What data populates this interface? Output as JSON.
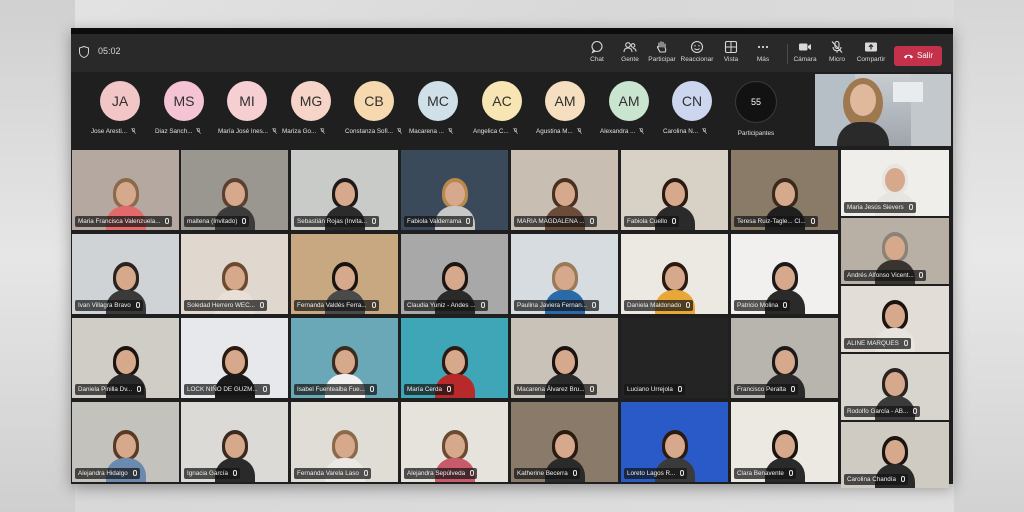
{
  "topbar": {
    "timer": "05:02",
    "tools": [
      {
        "label": "Chat",
        "icon": "chat-icon"
      },
      {
        "label": "Gente",
        "icon": "people-icon"
      },
      {
        "label": "Participar",
        "icon": "raise-hand-icon"
      },
      {
        "label": "Reaccionar",
        "icon": "reaction-icon"
      },
      {
        "label": "Vista",
        "icon": "view-icon"
      },
      {
        "label": "Más",
        "icon": "more-icon"
      },
      {
        "label": "Cámara",
        "icon": "camera-icon"
      },
      {
        "label": "Micro",
        "icon": "mic-off-icon"
      },
      {
        "label": "Compartir",
        "icon": "share-icon"
      }
    ],
    "leave_label": "Salir"
  },
  "roster": [
    {
      "initials": "JA",
      "name": "Jose Aresti...",
      "color": "#f2c5c7"
    },
    {
      "initials": "MS",
      "name": "Diaz Sanch...",
      "color": "#f4c4d4"
    },
    {
      "initials": "MI",
      "name": "María José Ines...",
      "color": "#f6cfd3"
    },
    {
      "initials": "MG",
      "name": "Mariza Go...",
      "color": "#f7d4c8"
    },
    {
      "initials": "CB",
      "name": "Constanza Sofi...",
      "color": "#f7d9b0"
    },
    {
      "initials": "MC",
      "name": "Macarena ...",
      "color": "#cfe0e8"
    },
    {
      "initials": "AC",
      "name": "Angelica C...",
      "color": "#f7e6b3"
    },
    {
      "initials": "AM",
      "name": "Agustina M...",
      "color": "#f5dfc0"
    },
    {
      "initials": "AM",
      "name": "Alexandra ...",
      "color": "#c9e4cf"
    },
    {
      "initials": "CN",
      "name": "Carolina N...",
      "color": "#cdd6ef"
    }
  ],
  "participants": {
    "count": "55",
    "label": "Participantes"
  },
  "tiles": [
    {
      "name": "Maria Francisca Valenzuela...",
      "wall": "#b5a8a0",
      "hair": "#8a6a4a",
      "shirt": "#e26a6a"
    },
    {
      "name": "maitena (Invitado)",
      "wall": "#9a9690",
      "hair": "#5a4030",
      "shirt": "#3b3b3b"
    },
    {
      "name": "Sebastián Rojas (Invita...",
      "wall": "#c9cbc8",
      "hair": "#1e1a18",
      "shirt": "#2b2b2b"
    },
    {
      "name": "Fabiola Valderrama",
      "wall": "#3a4a5a",
      "hair": "#b8894a",
      "shirt": "#c8c8c8"
    },
    {
      "name": "MARIA MAGDALENA ...",
      "wall": "#c8bfb2",
      "hair": "#4a3020",
      "shirt": "#6b4c3b"
    },
    {
      "name": "Fabiola Cuello",
      "wall": "#d8d2c6",
      "hair": "#2a1a12",
      "shirt": "#2a2a2a"
    },
    {
      "name": "Teresa Ruiz-Tagle... Cl...",
      "wall": "#8a7a68",
      "hair": "#3a2a1c",
      "shirt": "#1f1f1f"
    },
    {
      "name": "Maria Jesús Sievers",
      "wall": "#f0eeea",
      "hair": "#e8e4e0",
      "shirt": "#e8e4e0"
    },
    {
      "name": "Ivan Villagra Bravo",
      "wall": "#cfd3d6",
      "hair": "#2a2420",
      "shirt": "#3a3a3a"
    },
    {
      "name": "Soledad Herrero WEC...",
      "wall": "#e0d8ce",
      "hair": "#6a4a30",
      "shirt": "#e8e0d6"
    },
    {
      "name": "Fernanda Valdés Ferra...",
      "wall": "#c8a880",
      "hair": "#1a1410",
      "shirt": "#4a4a4a"
    },
    {
      "name": "Claudia Yuniz - Andes ...",
      "wall": "#a8a8a8",
      "hair": "#1c1612",
      "shirt": "#2a2a2a"
    },
    {
      "name": "Paulina Javiera Fernan...",
      "wall": "#d6dce0",
      "hair": "#9a7a58",
      "shirt": "#2a6aa8"
    },
    {
      "name": "Daniela Maldonado",
      "wall": "#ece8e2",
      "hair": "#2a1a10",
      "shirt": "#e8a838"
    },
    {
      "name": "Patricio Molina",
      "wall": "#f2f0ee",
      "hair": "#1a1a1a",
      "shirt": "#2a2a2a"
    },
    {
      "name": "Andrés Alfonso Vicent...",
      "wall": "#b8b0a4",
      "hair": "#8a8478",
      "shirt": "#3a3430"
    },
    {
      "name": "Daniela Pinilla Dv...",
      "wall": "#d0ccc6",
      "hair": "#1a1410",
      "shirt": "#2a2a2a"
    },
    {
      "name": "LOCK NIÑO DE GUZM...",
      "wall": "#e6e8ec",
      "hair": "#2a1a10",
      "shirt": "#1a1a1a"
    },
    {
      "name": "Isabel Fuentealba Fue...",
      "wall": "#6aa8b8",
      "hair": "#3a2a20",
      "shirt": "#f0f0f0"
    },
    {
      "name": "María Cerda",
      "wall": "#3fa6b8",
      "hair": "#2a1a12",
      "shirt": "#b82a2a"
    },
    {
      "name": "Macarena Álvarez Bru...",
      "wall": "#c8c2b8",
      "hair": "#1a1210",
      "shirt": "#2a2a2a"
    },
    {
      "name": "Luciano Urrejola",
      "wall": "#242424",
      "hair": "#242424",
      "shirt": "#242424"
    },
    {
      "name": "Francisco Peralta",
      "wall": "#b8b4ae",
      "hair": "#1a1a1a",
      "shirt": "#2a2a2a"
    },
    {
      "name": "ALINE MARQUES",
      "wall": "#e2ddd6",
      "hair": "#1a1410",
      "shirt": "#e8e4e0"
    },
    {
      "name": "Alejandra Hidalgo",
      "wall": "#c4c2bc",
      "hair": "#5a3a24",
      "shirt": "#6a8ab0"
    },
    {
      "name": "Ignacia García",
      "wall": "#dcdad6",
      "hair": "#3a2a1e",
      "shirt": "#2a2a2a"
    },
    {
      "name": "Fernanda Varela Laso",
      "wall": "#e0dcd6",
      "hair": "#8a6a4a",
      "shirt": "#ece8e4"
    },
    {
      "name": "Alejandra Sepúlveda",
      "wall": "#e6e2dc",
      "hair": "#6a4a30",
      "shirt": "#c85a6a"
    },
    {
      "name": "Katherine Becerra",
      "wall": "#8a7a6a",
      "hair": "#2a1a10",
      "shirt": "#2a2a2a"
    },
    {
      "name": "Loreto Lagos R...",
      "wall": "#2a5ac8",
      "hair": "#2a1a10",
      "shirt": "#3a3a3a"
    },
    {
      "name": "Clara Benavente",
      "wall": "#ece8e2",
      "hair": "#1a1410",
      "shirt": "#2a2a2a"
    },
    {
      "name": "Rodolfo García - AB...",
      "wall": "#d8d4ce",
      "hair": "#2a2420",
      "shirt": "#3a3a3a"
    },
    {
      "name": "Carolina Chandía",
      "wall": "#cfcac2",
      "hair": "#1a1410",
      "shirt": "#2a2a2a"
    }
  ]
}
